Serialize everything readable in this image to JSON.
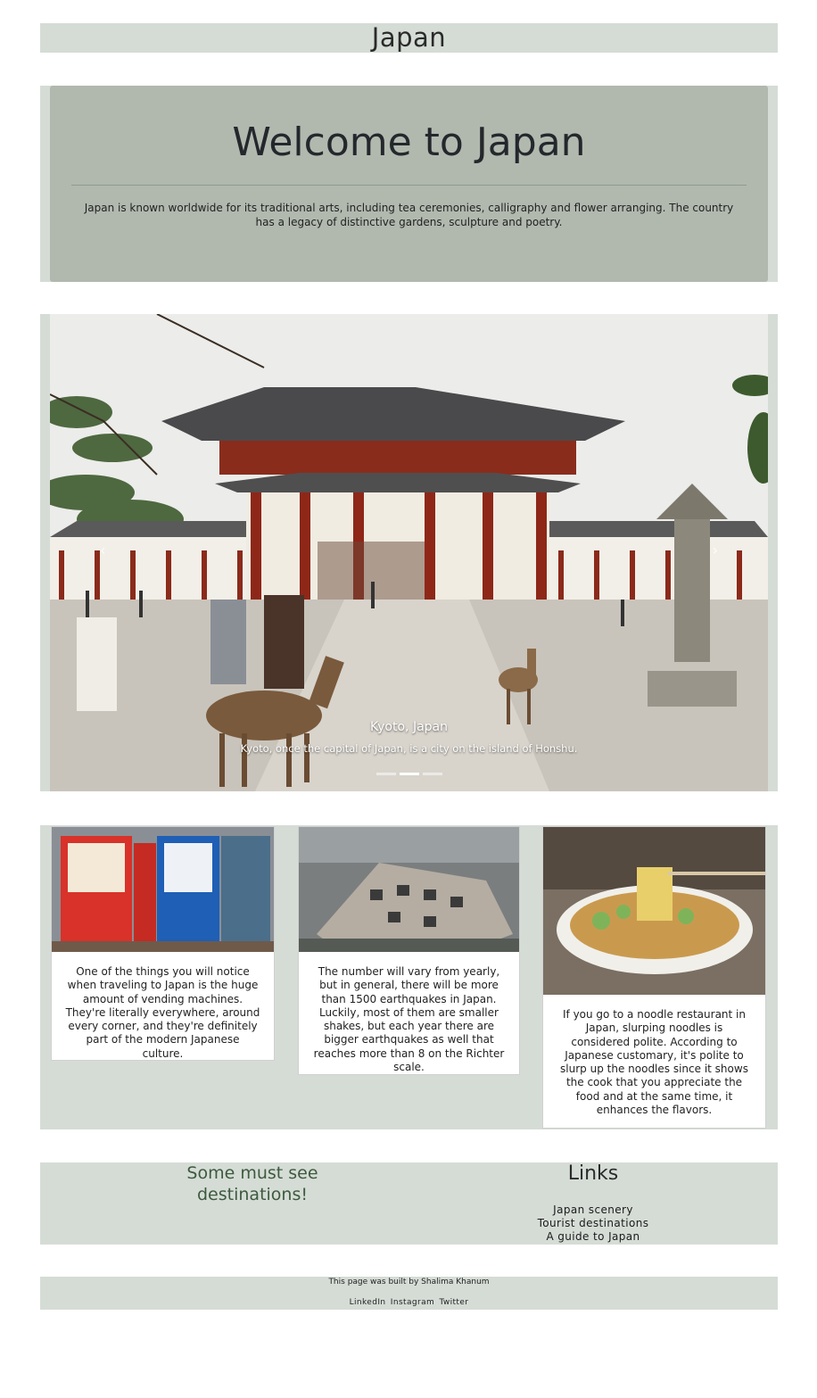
{
  "header": {
    "title": "Japan"
  },
  "welcome": {
    "heading": "Welcome to Japan",
    "text": "Japan is known worldwide for its traditional arts, including tea ceremonies, calligraphy and flower arranging. The country has a legacy of distinctive gardens, sculpture and poetry."
  },
  "carousel": {
    "slide_title": "Kyoto, Japan",
    "slide_text": "Kyoto, once the capital of Japan, is a city on the island of Honshu.",
    "indicator_count": 3,
    "active_index": 1
  },
  "cards": [
    {
      "image": "vending-machines",
      "text": "One of the things you will notice when traveling to Japan is the huge amount of vending machines. They're literally everywhere, around every corner, and they're definitely part of the modern Japanese culture."
    },
    {
      "image": "collapsed-building",
      "text": "The number will vary from yearly, but in general, there will be more than 1500 earthquakes in Japan. Luckily, most of them are smaller shakes, but each year there are bigger earthquakes as well that reaches more than 8 on the Richter scale."
    },
    {
      "image": "noodle-bowl",
      "text": "If you go to a noodle restaurant in Japan, slurping noodles is considered polite. According to Japanese customary, it's polite to slurp up the noodles since it shows the cook that you appreciate the food and at the same time, it enhances the flavors."
    }
  ],
  "destinations": {
    "title": "Some must see destinations!",
    "links_title": "Links",
    "links": [
      "Japan scenery",
      "Tourist destinations",
      "A guide to Japan"
    ]
  },
  "footer": {
    "built_by": "This page was built by Shalima Khanum",
    "social": [
      "LinkedIn",
      "Instagram",
      "Twitter"
    ]
  },
  "colors": {
    "band": "#d5dcd6",
    "jumbotron": "#b1b9af",
    "accent_green": "#3d5a3d"
  }
}
